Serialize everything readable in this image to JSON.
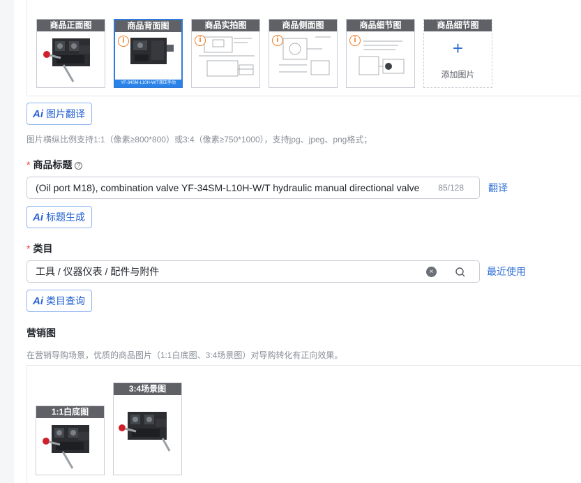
{
  "images": {
    "slots": [
      {
        "label": "商品正面图",
        "has_info": false,
        "selected": false,
        "caption": ""
      },
      {
        "label": "商品背面图",
        "has_info": true,
        "selected": true,
        "caption": "YF-34SM-L10H-W/T液压手动"
      },
      {
        "label": "商品实拍图",
        "has_info": true,
        "selected": false,
        "caption": ""
      },
      {
        "label": "商品侧面图",
        "has_info": true,
        "selected": false,
        "caption": ""
      },
      {
        "label": "商品细节图",
        "has_info": true,
        "selected": false,
        "caption": ""
      }
    ],
    "add_slot": {
      "label": "商品细节图",
      "plus": "+",
      "text": "添加图片"
    },
    "info_glyph": "i"
  },
  "image_translate": {
    "ai_glyph": "Ai",
    "label": "图片翻译"
  },
  "image_hint": "图片横纵比例支持1:1（像素≥800*800）或3:4（像素≥750*1000），支持jpg、jpeg、png格式；",
  "title_field": {
    "required_mark": "*",
    "label": "商品标题",
    "help_glyph": "?",
    "value": "(Oil port M18), combination valve YF-34SM-L10H-W/T hydraulic manual directional valve",
    "counter": "85/128",
    "translate_link": "翻译",
    "generate_button": {
      "ai_glyph": "Ai",
      "label": "标题生成"
    }
  },
  "category_field": {
    "required_mark": "*",
    "label": "类目",
    "value": "工具 / 仪器仪表 / 配件与附件",
    "clear_glyph": "×",
    "recent_link": "最近使用",
    "query_button": {
      "ai_glyph": "Ai",
      "label": "类目查询"
    }
  },
  "marketing": {
    "label": "营销图",
    "hint": "在营销导购场景，优质的商品图片（1:1白底图、3:4场景图）对导购转化有正向效果。",
    "slots": [
      {
        "label": "1:1白底图"
      },
      {
        "label": "3:4场景图"
      }
    ]
  },
  "colors": {
    "accent": "#2f6fd6",
    "required": "#e8412c",
    "warning": "#f07a1e"
  }
}
